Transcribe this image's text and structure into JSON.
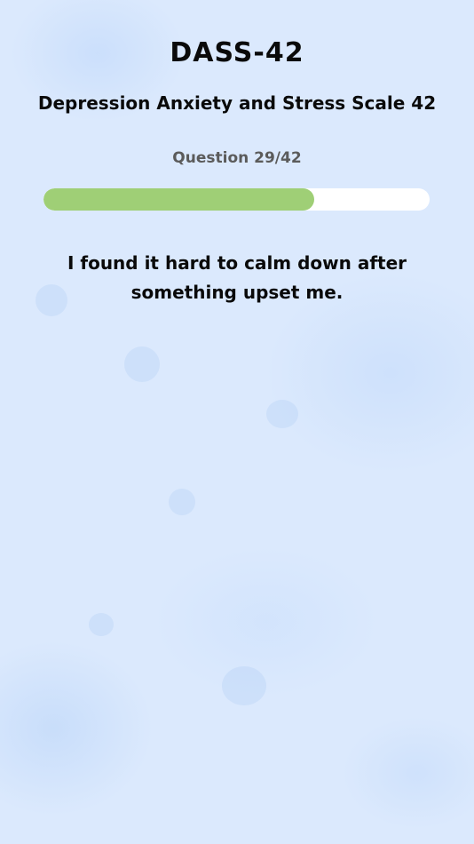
{
  "app": {
    "title": "DASS-42",
    "subtitle": "Depression Anxiety and Stress Scale 42"
  },
  "progress": {
    "label": "Question 29/42",
    "current": 29,
    "total": 42,
    "fraction": 0.7
  },
  "question": {
    "text": "I found it hard to calm down after something upset me."
  },
  "colors": {
    "background": "#dbe9fd",
    "progress_fill": "#9fcf76",
    "progress_track": "#ffffff",
    "label_gray": "#5b5b5b",
    "text": "#0a0a0a"
  }
}
